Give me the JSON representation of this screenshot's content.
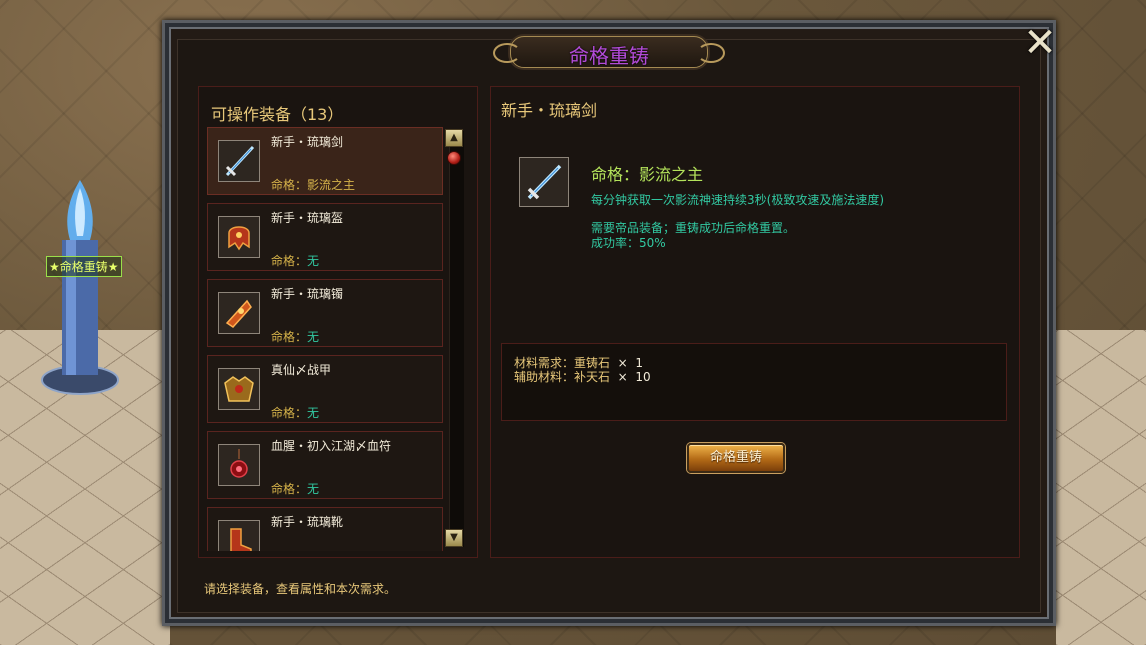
{
  "window": {
    "title": "命格重铸",
    "close_label": "✕"
  },
  "npc": {
    "label": "★命格重铸★"
  },
  "equipment_list": {
    "header": "可操作装备（13）",
    "items": [
      {
        "name": "新手・琉璃剑",
        "fate_label": "命格：",
        "fate_value": "影流之主",
        "icon": "sword-icon",
        "selected": true
      },
      {
        "name": "新手・琉璃盔",
        "fate_label": "命格：",
        "fate_value": "无",
        "icon": "helmet-icon",
        "selected": false
      },
      {
        "name": "新手・琉璃镯",
        "fate_label": "命格：",
        "fate_value": "无",
        "icon": "bracelet-icon",
        "selected": false
      },
      {
        "name": "真仙〆战甲",
        "fate_label": "命格：",
        "fate_value": "无",
        "icon": "armor-icon",
        "selected": false
      },
      {
        "name": "血腥・初入江湖〆血符",
        "fate_label": "命格：",
        "fate_value": "无",
        "icon": "talisman-icon",
        "selected": false
      },
      {
        "name": "新手・琉璃靴",
        "fate_label": "",
        "fate_value": "",
        "icon": "boots-icon",
        "selected": false
      }
    ]
  },
  "detail": {
    "item_name": "新手・琉璃剑",
    "fate_title": "命格：影流之主",
    "effect": "每分钟获取一次影流神速持续3秒(极致攻速及施法速度)",
    "requirement": "需要帝品装备；重铸成功后命格重置。",
    "success_rate": "成功率：50%"
  },
  "materials": {
    "line1_label": "材料需求：",
    "line1_item": "重铸石",
    "line1_qty": "  ×  1",
    "line2_label": "辅助材料：",
    "line2_item": "补天石",
    "line2_qty": "  ×  10"
  },
  "actions": {
    "recast_label": "命格重铸"
  },
  "footer": {
    "hint": "请选择装备，查看属性和本次需求。"
  },
  "colors": {
    "title": "#b24bd8",
    "gold_text": "#e8c87a",
    "teal_text": "#32c9a2",
    "fate_green": "#b4e35b",
    "panel_border": "#4b1d19"
  }
}
